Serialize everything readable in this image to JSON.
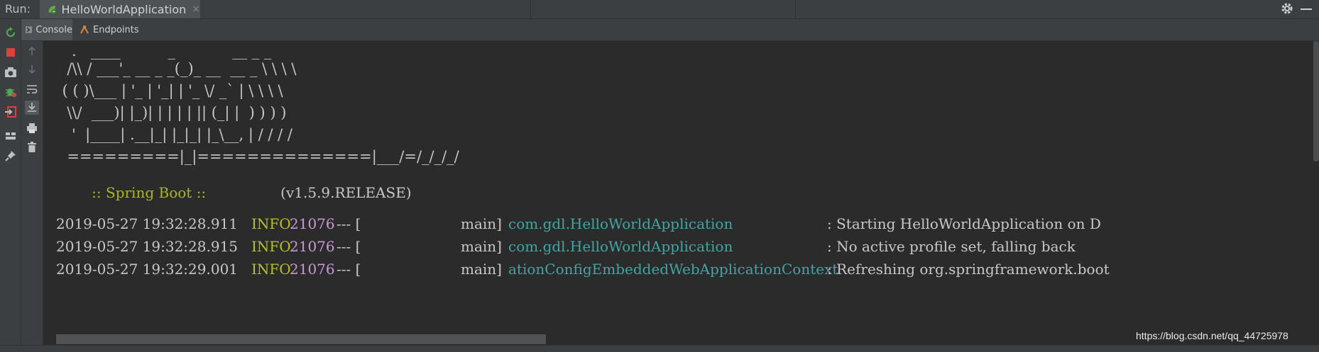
{
  "runbar": {
    "label": "Run:",
    "tab_title": "HelloWorldApplication",
    "tab_close": "×"
  },
  "tabs": [
    {
      "label": "Console"
    },
    {
      "label": "Endpoints"
    }
  ],
  "banner": {
    "lines": [
      "   .   ____          _            __ _ _",
      "  /\\\\ / ___'_ __ _ _(_)_ __  __ _ \\ \\ \\ \\",
      " ( ( )\\___ | '_ | '_| | '_ \\/ _` | \\ \\ \\ \\",
      "  \\\\/  ___)| |_)| | | | | || (_| |  ) ) ) )",
      "   '  |____| .__|_| |_|_| |_\\__, | / / / /",
      "  =========|_|==============|___/=/_/_/_/"
    ],
    "spring_label": ":: Spring Boot ::",
    "spring_version": "(v1.5.9.RELEASE)"
  },
  "log_lines": [
    {
      "ts": "2019-05-27 19:32:28.911",
      "level": "INFO",
      "pid": "21076",
      "sep": "--- [",
      "thread": "main]",
      "logger": "com.gdl.HelloWorldApplication",
      "msg": ": Starting HelloWorldApplication on D"
    },
    {
      "ts": "2019-05-27 19:32:28.915",
      "level": "INFO",
      "pid": "21076",
      "sep": "--- [",
      "thread": "main]",
      "logger": "com.gdl.HelloWorldApplication",
      "msg": ": No active profile set, falling back"
    },
    {
      "ts": "2019-05-27 19:32:29.001",
      "level": "INFO",
      "pid": "21076",
      "sep": "--- [",
      "thread": "main]",
      "logger": "ationConfigEmbeddedWebApplicationContext",
      "msg": ": Refreshing org.springframework.boot"
    }
  ],
  "watermark": "https://blog.csdn.net/qq_44725978",
  "colors": {
    "background": "#2b2b2b",
    "toolbar": "#3c3f41",
    "info": "#b8c21d",
    "pid": "#c79ad3",
    "logger": "#3fa6a3",
    "spring": "#a8b81d"
  },
  "icons": {
    "left_toolbar": [
      "rerun-icon",
      "stop-icon",
      "camera-icon",
      "debug-bug-icon",
      "exit-icon",
      "layout-icon",
      "pin-icon"
    ],
    "inner_toolbar": [
      "arrow-up-icon",
      "arrow-down-icon",
      "soft-wrap-icon",
      "scroll-to-end-icon",
      "print-icon",
      "trash-icon"
    ]
  }
}
